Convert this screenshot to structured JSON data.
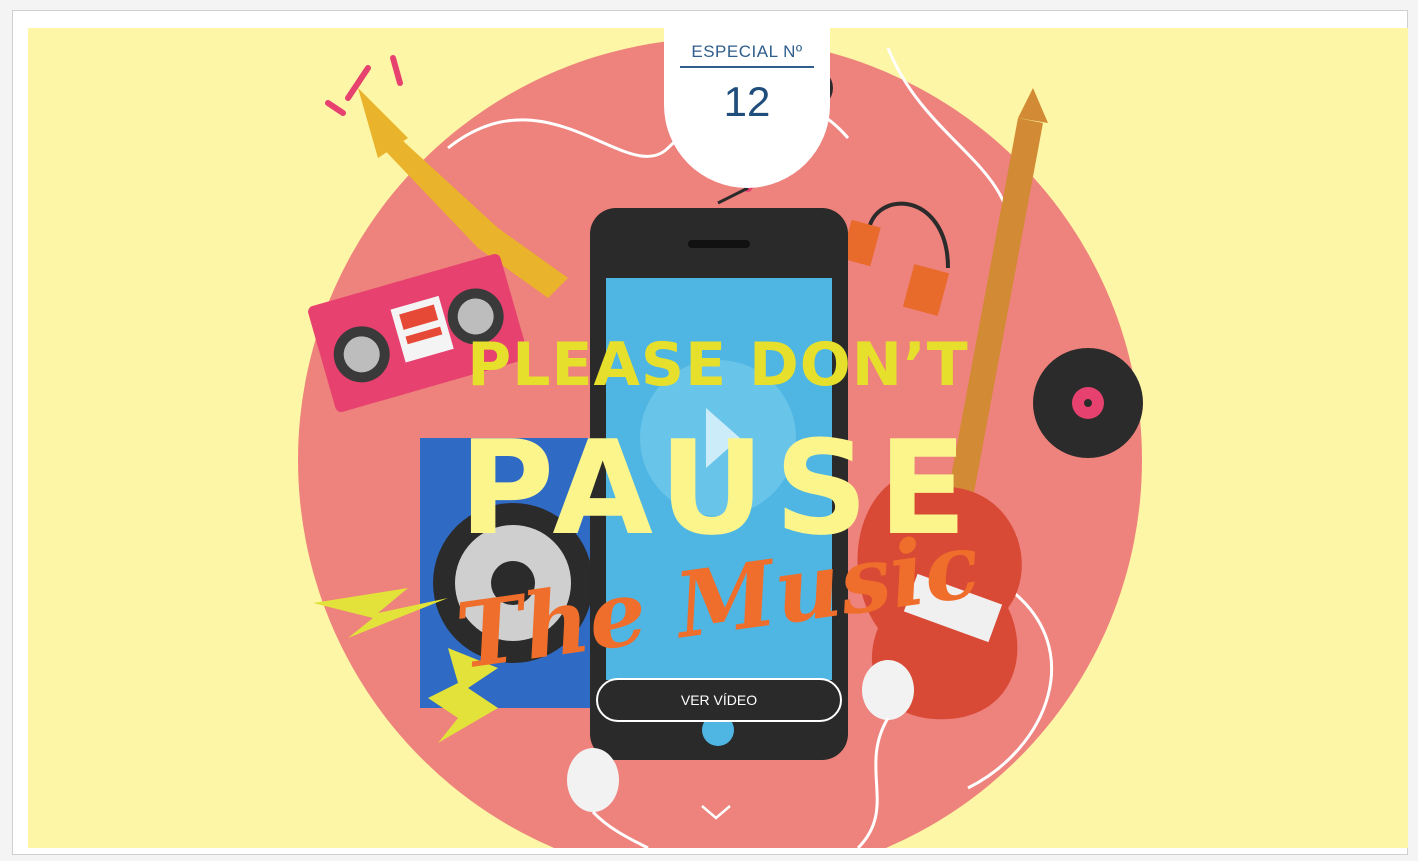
{
  "badge": {
    "label": "ESPECIAL Nº",
    "number": "12"
  },
  "hero": {
    "title_line1": "PLEASE DON’T",
    "title_line2": "PAUSE",
    "title_line3": "The Music"
  },
  "video_button": {
    "label": "VER VÍDEO"
  },
  "icons": {
    "play": "play-icon",
    "scroll": "chevron-down-icon"
  },
  "colors": {
    "background": "#fdf6a6",
    "disc": "#ee827c",
    "title_yellow": "#e6df2b",
    "title_cream": "#fbf58c",
    "title_orange": "#ef6e2b",
    "badge_blue": "#2f5d8c"
  }
}
